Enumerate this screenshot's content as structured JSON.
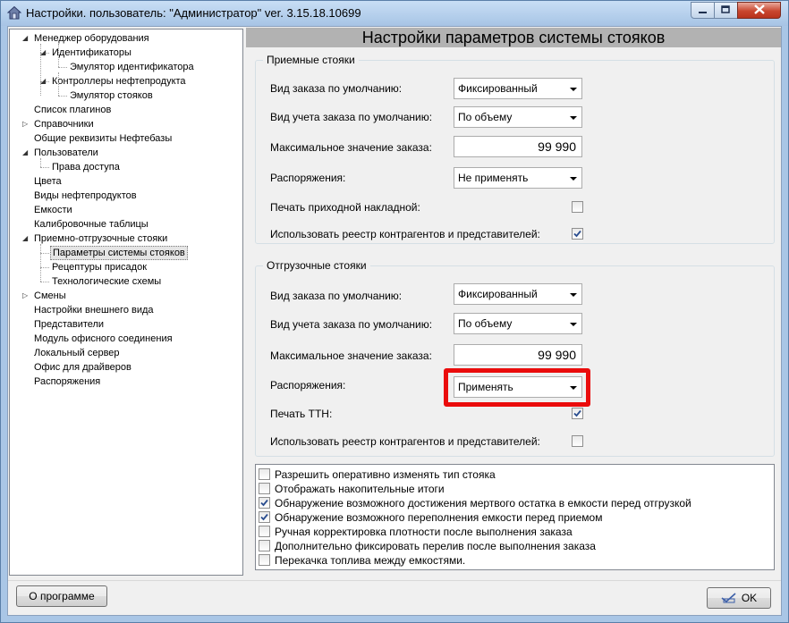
{
  "window": {
    "title": "Настройки. пользователь: \"Администратор\" ver. 3.15.18.10699"
  },
  "tree": [
    {
      "label": "Менеджер оборудования",
      "level": 0,
      "expander": "expanded"
    },
    {
      "label": "Идентификаторы",
      "level": 1,
      "expander": "expanded"
    },
    {
      "label": "Эмулятор идентификатора",
      "level": 2,
      "expander": "none"
    },
    {
      "label": "Контроллеры нефтепродукта",
      "level": 1,
      "expander": "expanded"
    },
    {
      "label": "Эмулятор стояков",
      "level": 2,
      "expander": "none"
    },
    {
      "label": "Список плагинов",
      "level": 0,
      "expander": "none"
    },
    {
      "label": "Справочники",
      "level": 0,
      "expander": "collapsed"
    },
    {
      "label": "Общие реквизиты Нефтебазы",
      "level": 0,
      "expander": "none"
    },
    {
      "label": "Пользователи",
      "level": 0,
      "expander": "expanded"
    },
    {
      "label": "Права доступа",
      "level": 1,
      "expander": "none"
    },
    {
      "label": "Цвета",
      "level": 0,
      "expander": "none"
    },
    {
      "label": "Виды нефтепродуктов",
      "level": 0,
      "expander": "none"
    },
    {
      "label": "Емкости",
      "level": 0,
      "expander": "none"
    },
    {
      "label": "Калибровочные таблицы",
      "level": 0,
      "expander": "none"
    },
    {
      "label": "Приемно-отгрузочные стояки",
      "level": 0,
      "expander": "expanded"
    },
    {
      "label": "Параметры системы стояков",
      "level": 1,
      "expander": "none",
      "selected": true
    },
    {
      "label": "Рецептуры присадок",
      "level": 1,
      "expander": "none"
    },
    {
      "label": "Технологические схемы",
      "level": 1,
      "expander": "none"
    },
    {
      "label": "Смены",
      "level": 0,
      "expander": "collapsed"
    },
    {
      "label": "Настройки внешнего вида",
      "level": 0,
      "expander": "none"
    },
    {
      "label": "Представители",
      "level": 0,
      "expander": "none"
    },
    {
      "label": "Модуль офисного соединения",
      "level": 0,
      "expander": "none"
    },
    {
      "label": "Локальный сервер",
      "level": 0,
      "expander": "none"
    },
    {
      "label": "Офис для драйверов",
      "level": 0,
      "expander": "none"
    },
    {
      "label": "Распоряжения",
      "level": 0,
      "expander": "none"
    }
  ],
  "panel": {
    "title": "Настройки параметров системы стояков"
  },
  "receiving": {
    "legend": "Приемные стояки",
    "order_type_label": "Вид заказа по умолчанию:",
    "order_type_value": "Фиксированный",
    "accounting_label": "Вид учета заказа по умолчанию:",
    "accounting_value": "По объему",
    "max_label": "Максимальное значение заказа:",
    "max_value": "99 990",
    "orders_label": "Распоряжения:",
    "orders_value": "Не применять",
    "print_label": "Печать приходной накладной:",
    "print_checked": false,
    "registry_label": "Использовать реестр контрагентов и представителей:",
    "registry_checked": true
  },
  "shipping": {
    "legend": "Отгрузочные стояки",
    "order_type_label": "Вид заказа по умолчанию:",
    "order_type_value": "Фиксированный",
    "accounting_label": "Вид учета заказа по умолчанию:",
    "accounting_value": "По объему",
    "max_label": "Максимальное значение заказа:",
    "max_value": "99 990",
    "orders_label": "Распоряжения:",
    "orders_value": "Применять",
    "print_label": "Печать ТТН:",
    "print_checked": true,
    "registry_label": "Использовать реестр контрагентов и представителей:",
    "registry_checked": false
  },
  "options": [
    {
      "label": "Разрешить оперативно изменять тип стояка",
      "checked": false
    },
    {
      "label": "Отображать накопительные итоги",
      "checked": false
    },
    {
      "label": "Обнаружение возможного достижения мертвого остатка в емкости перед отгрузкой",
      "checked": true
    },
    {
      "label": "Обнаружение возможного переполнения емкости перед приемом",
      "checked": true
    },
    {
      "label": "Ручная корректировка плотности после выполнения заказа",
      "checked": false
    },
    {
      "label": "Дополнительно фиксировать перелив после выполнения заказа",
      "checked": false
    },
    {
      "label": "Перекачка топлива между емкостями.",
      "checked": false
    }
  ],
  "buttons": {
    "about": "О программе",
    "ok": "OK"
  },
  "colors": {
    "highlight": "#ea0c0c",
    "header_bg": "#b2b2b2",
    "check": "#2a4d8f"
  }
}
